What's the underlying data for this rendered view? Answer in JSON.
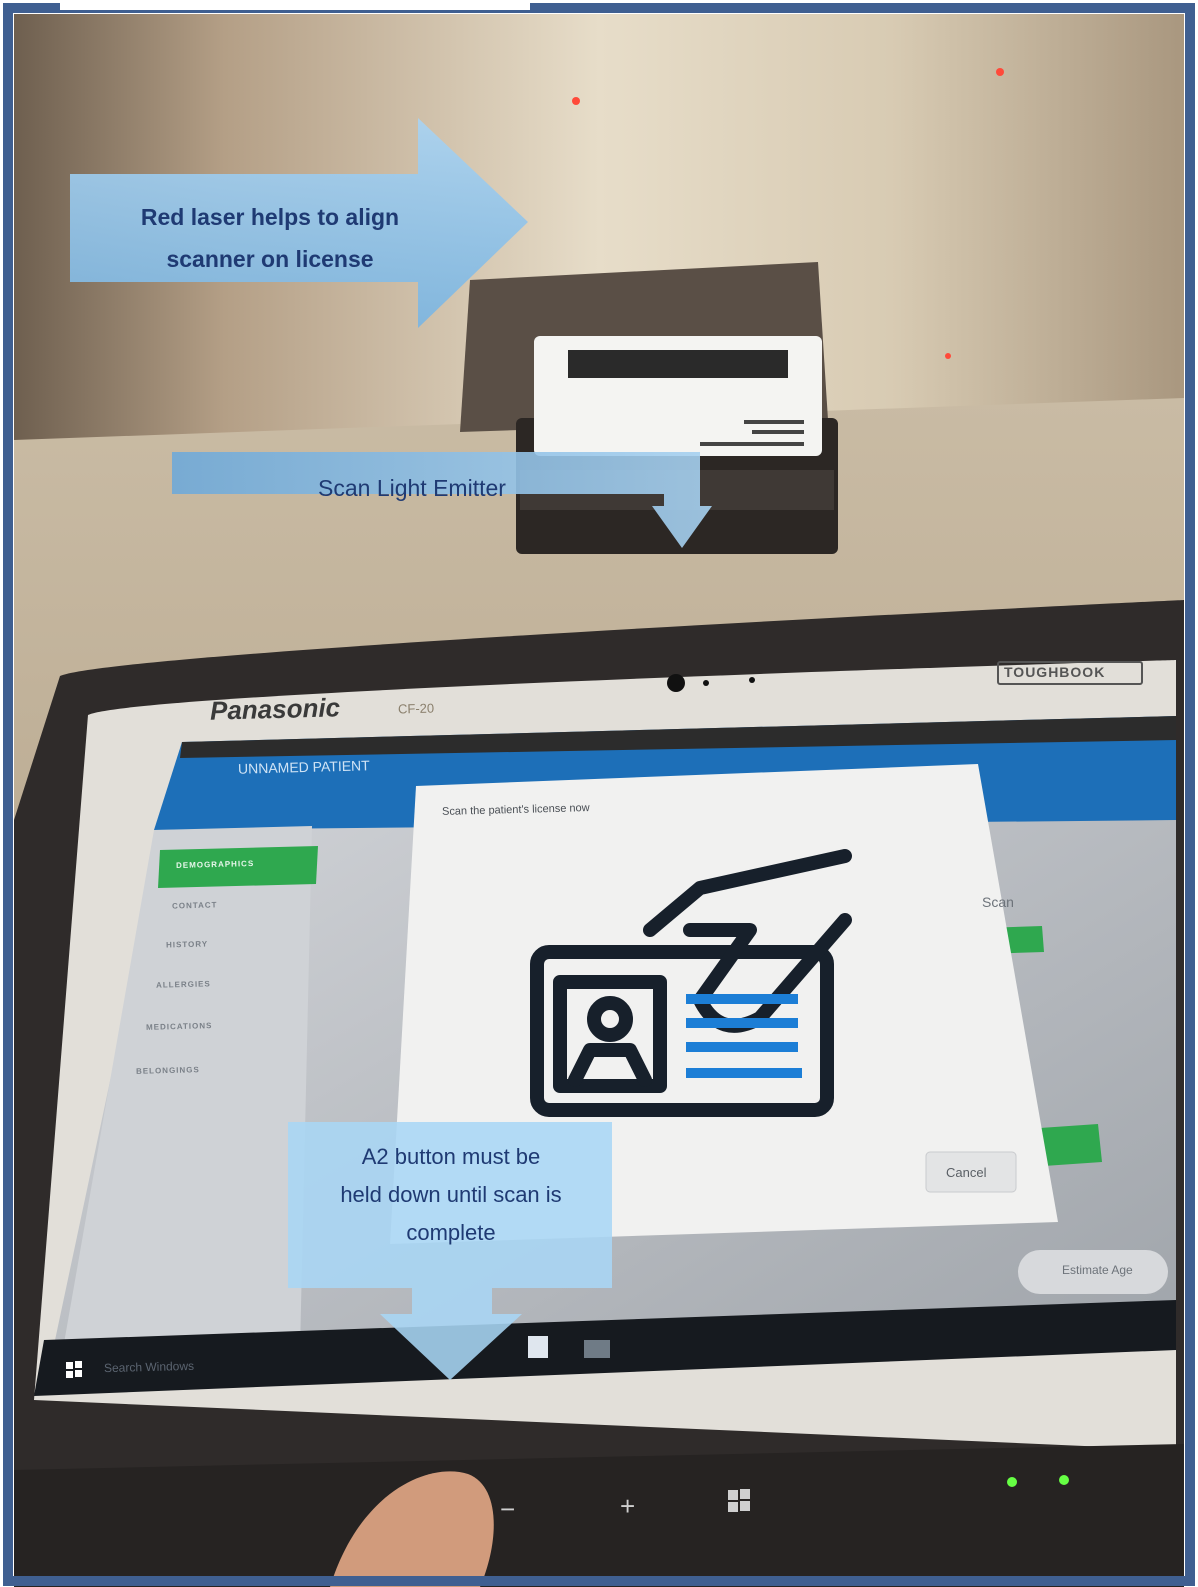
{
  "callouts": {
    "laser": {
      "line1": "Red laser helps to align",
      "line2": "scanner on license"
    },
    "emitter": {
      "label": "Scan Light Emitter"
    },
    "a2": {
      "line1": "A2 button must be",
      "line2": "held down until scan is",
      "line3": "complete"
    }
  },
  "device": {
    "brand": "Panasonic",
    "model": "CF-20",
    "badge": "TOUGHBOOK"
  },
  "app": {
    "patient_selector": "UNNAMED PATIENT",
    "sidebar": [
      "DEMOGRAPHICS",
      "CONTACT",
      "HISTORY",
      "ALLERGIES",
      "MEDICATIONS",
      "BELONGINGS"
    ],
    "right_panel_label": "Scan",
    "estimate_age": "Estimate Age"
  },
  "dialog": {
    "title": "Scan the patient's license now",
    "icon": "id-card-scan-icon",
    "cancel": "Cancel"
  },
  "taskbar": {
    "search_placeholder": "Search Windows"
  },
  "colors": {
    "app_header": "#1d6fb8",
    "accent_green": "#2fa84f",
    "icon_blue": "#1c7ed6",
    "callout_text": "#1f3a73",
    "callout_fill": "#8fc4ea",
    "frame": "#3f5f91"
  }
}
